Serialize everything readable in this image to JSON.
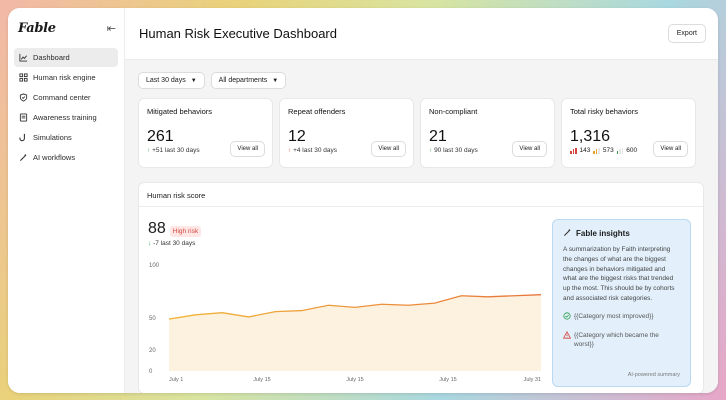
{
  "sidebar": {
    "logo": "Fable",
    "items": [
      {
        "label": "Dashboard",
        "icon": "chart-line-icon"
      },
      {
        "label": "Human risk engine",
        "icon": "grid-icon"
      },
      {
        "label": "Command center",
        "icon": "shield-icon"
      },
      {
        "label": "Awareness training",
        "icon": "book-icon"
      },
      {
        "label": "Simulations",
        "icon": "hook-icon"
      },
      {
        "label": "AI workflows",
        "icon": "wand-icon"
      }
    ]
  },
  "header": {
    "title": "Human Risk Executive Dashboard",
    "export_label": "Export"
  },
  "filters": {
    "period": "Last 30 days",
    "departments": "All departments"
  },
  "cards": [
    {
      "title": "Mitigated behaviors",
      "value": "261",
      "delta": "+51 last 30 days",
      "button": "View all"
    },
    {
      "title": "Repeat offenders",
      "value": "12",
      "delta": "+4 last 30 days",
      "button": "View all"
    },
    {
      "title": "Non-compliant",
      "value": "21",
      "delta": "90 last 30 days",
      "button": "View all"
    },
    {
      "title": "Total risky behaviors",
      "value": "1,316",
      "high": "143",
      "medium": "573",
      "low": "600",
      "button": "View all"
    }
  ],
  "score": {
    "title": "Human risk score",
    "value": "88",
    "badge": "High risk",
    "delta": "-7 last 30 days"
  },
  "insights": {
    "title": "Fable insights",
    "description": "A summarization by Faith interpreting the changes of what are the biggest changes in behaviors mitigated and what are the biggest risks that trended up the most. This should be by cohorts and associated risk categories.",
    "improved": "{{Category most improved}}",
    "worst": "{{Category which became the worst}}",
    "footer": "AI-powered summary"
  },
  "colors": {
    "line": "#e8743b",
    "fill": "#fdf1dc",
    "green": "#2a9d4a",
    "red": "#d6453d",
    "insight_bg": "#e3f0fb"
  },
  "chart_data": {
    "type": "line",
    "x_ticks": [
      "July 1",
      "July 15",
      "July 15",
      "July 15",
      "July 31"
    ],
    "y_ticks": [
      "0",
      "20",
      "50",
      "100"
    ],
    "ylim": [
      0,
      100
    ],
    "values": [
      49,
      53,
      55,
      51,
      56,
      57,
      62,
      60,
      63,
      62,
      64,
      71,
      70,
      71,
      72
    ]
  }
}
